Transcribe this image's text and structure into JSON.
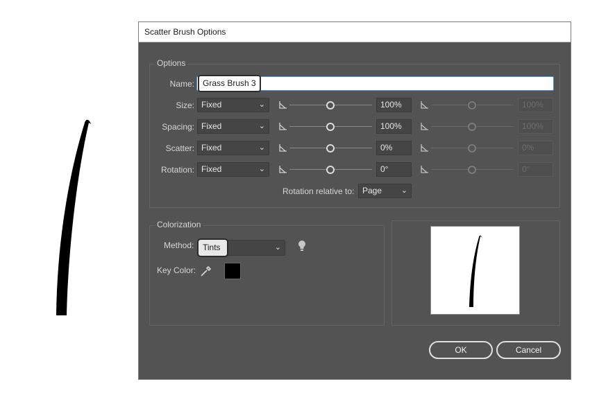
{
  "dialog": {
    "title": "Scatter Brush Options"
  },
  "options": {
    "group_title": "Options",
    "name_label": "Name:",
    "name_value": "Grass Brush 3",
    "rows": [
      {
        "label": "Size:",
        "mode": "Fixed",
        "value": "100%",
        "max_value": "100%",
        "level": 0.5
      },
      {
        "label": "Spacing:",
        "mode": "Fixed",
        "value": "100%",
        "max_value": "100%",
        "level": 0.5
      },
      {
        "label": "Scatter:",
        "mode": "Fixed",
        "value": "0%",
        "max_value": "0%",
        "level": 0.5
      },
      {
        "label": "Rotation:",
        "mode": "Fixed",
        "value": "0°",
        "max_value": "0°",
        "level": 0.5
      }
    ],
    "rotation_relative_label": "Rotation relative to:",
    "rotation_relative_value": "Page"
  },
  "colorization": {
    "group_title": "Colorization",
    "method_label": "Method:",
    "method_value": "Tints",
    "key_color_label": "Key Color:",
    "key_color": "#000000"
  },
  "buttons": {
    "ok": "OK",
    "cancel": "Cancel"
  },
  "colors": {
    "dialog_bg": "#535353",
    "focus": "#4a90d9"
  },
  "icons": {
    "variation": "variation-arrow-icon",
    "tip": "lightbulb-icon",
    "eyedropper": "eyedropper-icon",
    "dropdown": "chevron-down-icon"
  }
}
